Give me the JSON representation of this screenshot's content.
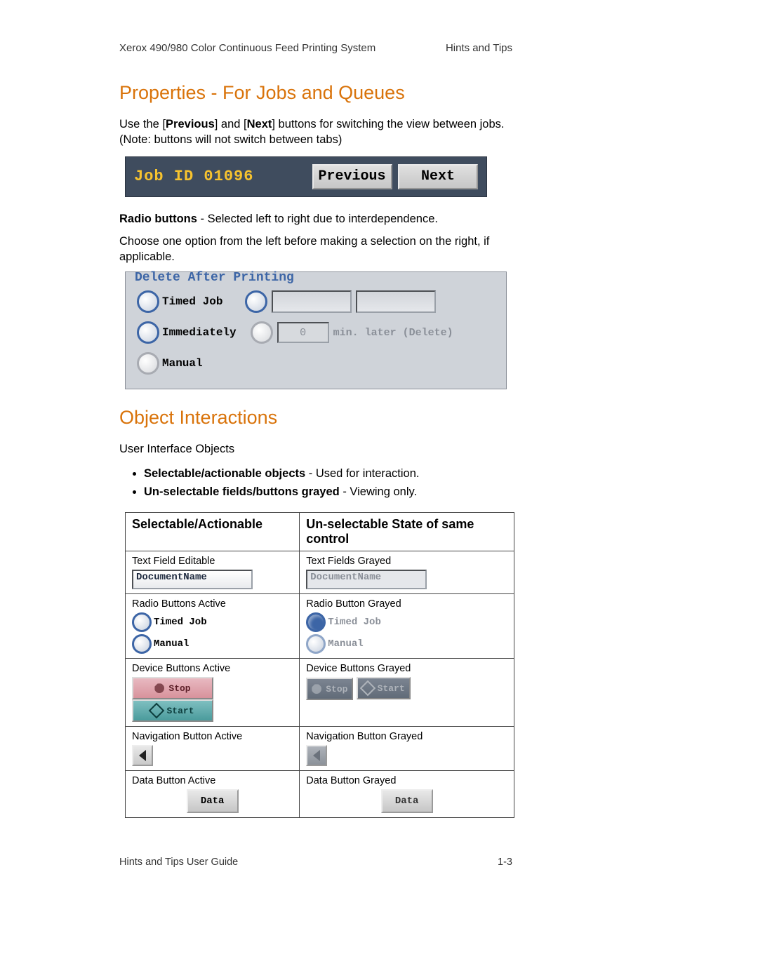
{
  "header": {
    "left": "Xerox 490/980 Color Continuous Feed Printing System",
    "right": "Hints and Tips"
  },
  "h_properties": "Properties - For Jobs and Queues",
  "p_prevnext_a": "Use the [",
  "p_prevnext_b": "Previous",
  "p_prevnext_c": "] and [",
  "p_prevnext_d": "Next",
  "p_prevnext_e": "] buttons for switching the view between jobs. (Note: buttons will not switch between tabs)",
  "jobbar": {
    "id_label": "Job ID 01096",
    "prev": "Previous",
    "next": "Next"
  },
  "p_radio_a": "Radio buttons",
  "p_radio_b": " - Selected left to right due to interdependence.",
  "p_choose": "Choose one option from the left before making a selection on the right, if applicable.",
  "dap": {
    "legend": "Delete After Printing",
    "timed": "Timed Job",
    "immediately": "Immediately",
    "manual": "Manual",
    "num": "0",
    "min_later": "min. later (Delete)"
  },
  "h_object": "Object Interactions",
  "p_uio": "User Interface Objects",
  "li1a": "Selectable/actionable objects",
  "li1b": " - Used for interaction.",
  "li2a": "Un-selectable fields/buttons grayed",
  "li2b": " - Viewing only.",
  "table": {
    "th1": "Selectable/Actionable",
    "th2": "Un-selectable State of same control",
    "r1": {
      "a": "Text Field Editable",
      "b": "Text Fields Grayed",
      "val": "DocumentName"
    },
    "r2": {
      "a": "Radio Buttons Active",
      "b": "Radio Button Grayed",
      "timed": "Timed Job",
      "manual": "Manual"
    },
    "r3": {
      "a": "Device Buttons Active",
      "b": "Device Buttons Grayed",
      "stop": "Stop",
      "start": "Start"
    },
    "r4": {
      "a": "Navigation Button Active",
      "b": "Navigation Button Grayed"
    },
    "r5": {
      "a": "Data Button Active",
      "b": "Data Button Grayed",
      "data": "Data"
    }
  },
  "footer": {
    "left": "Hints and Tips User Guide",
    "right": "1-3"
  }
}
